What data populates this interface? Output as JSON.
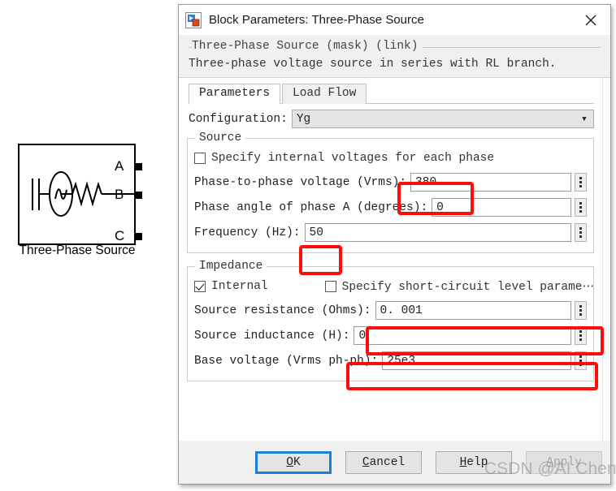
{
  "block": {
    "caption": "Three-Phase Source",
    "ports": [
      {
        "label": "A"
      },
      {
        "label": "B"
      },
      {
        "label": "C"
      }
    ],
    "icon_name": "three-phase-source-block"
  },
  "dialog": {
    "title": "Block Parameters: Three-Phase Source",
    "title_icon": "simulink-block-icon",
    "close_label": "✕",
    "description": {
      "heading": "Three-Phase Source (mask) (link)",
      "body": "Three-phase voltage source in series with RL branch."
    },
    "tabs": [
      {
        "label": "Parameters",
        "active": true
      },
      {
        "label": "Load Flow",
        "active": false
      }
    ],
    "configuration": {
      "label": "Configuration:",
      "value": "Yg",
      "arrow": "▼"
    },
    "source_group": {
      "legend": "Source",
      "specify_internal": {
        "label": "Specify internal voltages for each phase",
        "checked": false
      },
      "fields": [
        {
          "label": "Phase-to-phase voltage (Vrms):",
          "value": "380",
          "highlighted": true
        },
        {
          "label": "Phase angle of phase A (degrees):",
          "value": "0",
          "highlighted": false
        },
        {
          "label": "Frequency (Hz):",
          "value": "50",
          "highlighted": true
        }
      ]
    },
    "impedance_group": {
      "legend": "Impedance",
      "internal": {
        "label": "Internal",
        "checked": true
      },
      "short_circuit": {
        "label": "Specify short-circuit level parame⋯",
        "checked": false
      },
      "fields": [
        {
          "label": "Source resistance (Ohms):",
          "value": "0. 001",
          "highlighted": true
        },
        {
          "label": "Source inductance (H):",
          "value": "0",
          "highlighted": true
        },
        {
          "label": "Base voltage (Vrms ph-ph):",
          "value": "25e3",
          "highlighted": false
        }
      ]
    },
    "buttons": [
      {
        "prefix": "",
        "accel": "O",
        "suffix": "K",
        "state": "default"
      },
      {
        "prefix": "",
        "accel": "C",
        "suffix": "ancel",
        "state": "normal"
      },
      {
        "prefix": "",
        "accel": "H",
        "suffix": "elp",
        "state": "normal"
      },
      {
        "prefix": "",
        "accel": "A",
        "suffix": "pply",
        "state": "disabled"
      }
    ]
  },
  "watermark": {
    "text": "CSDN @AI Chen"
  },
  "colors": {
    "accent": "#1c7fd6",
    "annotation": "#fc0d08",
    "dialog_bg": "#f0f0f0"
  }
}
